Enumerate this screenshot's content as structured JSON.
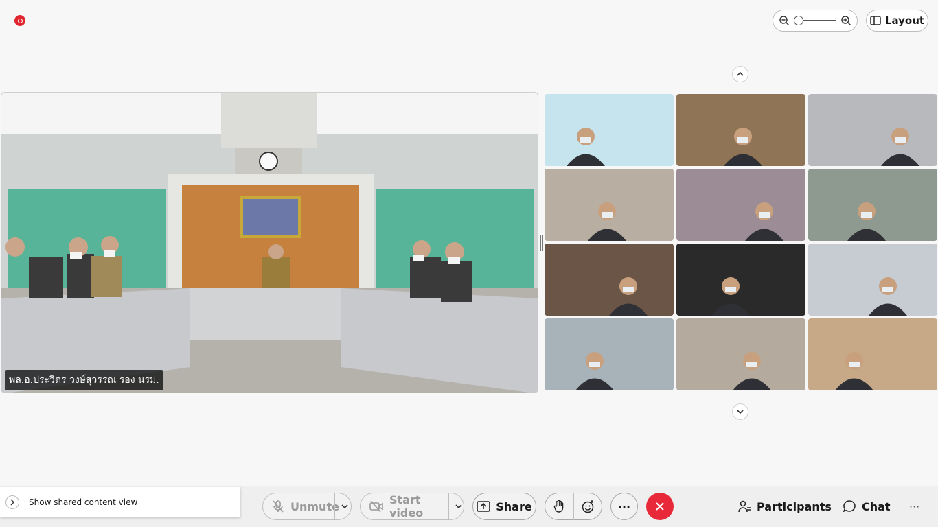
{
  "top": {
    "layout_label": "Layout",
    "zoom_level": 0
  },
  "main_video": {
    "speaker_name": "พล.อ.ประวิตร วงษ์สุวรรณ รอง นรม."
  },
  "participants_grid": [
    {
      "id": "tile-1",
      "bg": "#c6e4ee"
    },
    {
      "id": "tile-2",
      "bg": "#8f7455"
    },
    {
      "id": "tile-3",
      "bg": "#b7b9bd"
    },
    {
      "id": "tile-4",
      "bg": "#b8aea2"
    },
    {
      "id": "tile-5",
      "bg": "#9b8c96"
    },
    {
      "id": "tile-6",
      "bg": "#8e9a8f"
    },
    {
      "id": "tile-7",
      "bg": "#6b5547"
    },
    {
      "id": "tile-8",
      "bg": "#2a2a2a"
    },
    {
      "id": "tile-9",
      "bg": "#c7ccd2"
    },
    {
      "id": "tile-10",
      "bg": "#a7b3b8"
    },
    {
      "id": "tile-11",
      "bg": "#b4aa9e"
    },
    {
      "id": "tile-12",
      "bg": "#c7a987"
    }
  ],
  "share_panel": {
    "label": "Show shared content view"
  },
  "toolbar": {
    "unmute_label": "Unmute",
    "start_video_label": "Start video",
    "share_label": "Share",
    "participants_label": "Participants",
    "chat_label": "Chat",
    "more_glyph": "···",
    "overflow_glyph": "···"
  },
  "colors": {
    "end_call": "#e8293a",
    "recording": "#e0262f"
  }
}
